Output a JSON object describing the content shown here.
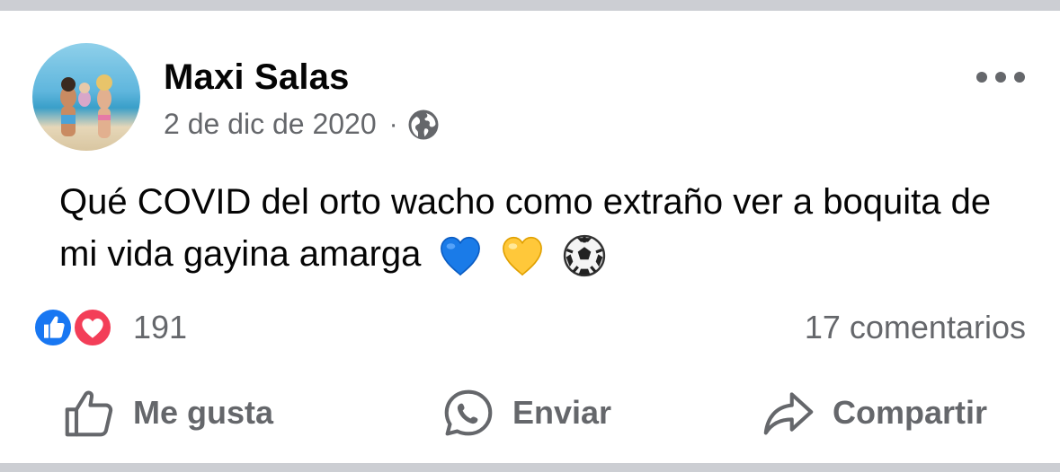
{
  "post": {
    "author": "Maxi Salas",
    "date": "2 de dic de 2020",
    "separator": "·",
    "privacy_icon": "globe-icon",
    "text": "Qué COVID del orto wacho como extraño ver a boquita de mi vida gayina amarga",
    "emojis": [
      "blue-heart",
      "yellow-heart",
      "soccer-ball"
    ]
  },
  "stats": {
    "reaction_count": "191",
    "reaction_icons": [
      "like-reaction-icon",
      "love-reaction-icon"
    ],
    "comments": "17 comentarios"
  },
  "actions": {
    "like_label": "Me gusta",
    "send_label": "Enviar",
    "share_label": "Compartir"
  },
  "colors": {
    "text_primary": "#050505",
    "text_secondary": "#65676b",
    "like_blue": "#1877f2",
    "love_red": "#f33e58",
    "background": "#ccced3"
  }
}
